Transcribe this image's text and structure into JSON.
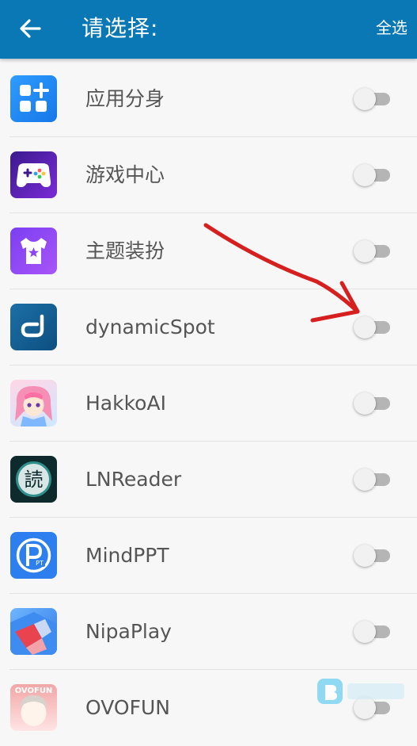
{
  "appbar": {
    "title": "请选择:",
    "select_all_label": "全选",
    "back_icon": "arrow-left-icon"
  },
  "apps": [
    {
      "name": "应用分身",
      "icon": "app-clone-icon",
      "enabled": false
    },
    {
      "name": "游戏中心",
      "icon": "game-center-icon",
      "enabled": false
    },
    {
      "name": "主题装扮",
      "icon": "theme-store-icon",
      "enabled": false
    },
    {
      "name": "dynamicSpot",
      "icon": "dynamicspot-icon",
      "enabled": false
    },
    {
      "name": "HakkoAI",
      "icon": "hakkoai-icon",
      "enabled": false
    },
    {
      "name": "LNReader",
      "icon": "lnreader-icon",
      "enabled": false
    },
    {
      "name": "MindPPT",
      "icon": "mindppt-icon",
      "enabled": false
    },
    {
      "name": "NipaPlay",
      "icon": "nipaplay-icon",
      "enabled": false
    },
    {
      "name": "OVOFUN",
      "icon": "ovofun-icon",
      "enabled": false
    }
  ],
  "icon_texts": {
    "lnreader_glyph": "読",
    "mindppt_glyph": "PT",
    "ovofun_logo": "OVOFUN"
  },
  "colors": {
    "appbar": "#0a78b4",
    "annotation_arrow": "#d62020",
    "toggle_track_off": "#b5b5b5"
  }
}
